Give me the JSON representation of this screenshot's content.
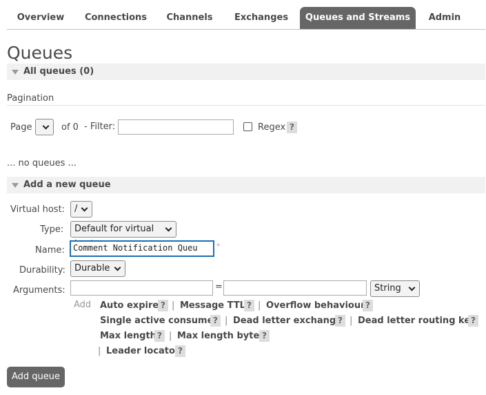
{
  "tabs": [
    {
      "label": "Overview"
    },
    {
      "label": "Connections"
    },
    {
      "label": "Channels"
    },
    {
      "label": "Exchanges"
    },
    {
      "label": "Queues and Streams",
      "active": true
    },
    {
      "label": "Admin"
    }
  ],
  "page_title": "Queues",
  "all_queues": {
    "label": "All queues (0)"
  },
  "pagination": {
    "label": "Pagination",
    "page_label": "Page",
    "of_text": "of 0",
    "filter_label": "- Filter:",
    "filter_value": "",
    "regex_label": "Regex",
    "regex_checked": false,
    "help": "?"
  },
  "no_queues_text": "... no queues ...",
  "add_queue_section": {
    "header": "Add a new queue",
    "virtual_host": {
      "label": "Virtual host:",
      "value": "/"
    },
    "type": {
      "label": "Type:",
      "value": "Default for virtual host"
    },
    "name": {
      "label": "Name:",
      "value": "Comment Notification Queu",
      "required_mark": "*"
    },
    "durability": {
      "label": "Durability:",
      "value": "Durable"
    },
    "arguments": {
      "label": "Arguments:",
      "key_value": "",
      "equals": "=",
      "value_value": "",
      "type_value": "String",
      "add_label": "Add",
      "shortcuts": {
        "auto_expire": "Auto expire",
        "message_ttl": "Message TTL",
        "overflow_behaviour": "Overflow behaviour",
        "single_active_consumer": "Single active consumer",
        "dead_letter_exchange": "Dead letter exchange",
        "dead_letter_routing_key": "Dead letter routing key",
        "max_length": "Max length",
        "max_length_bytes": "Max length bytes",
        "leader_locator": "Leader locator"
      },
      "separator": "|",
      "help": "?"
    },
    "submit_label": "Add queue"
  },
  "colors": {
    "active_tab": "#666666",
    "section_bg": "#f1f1f1",
    "focus_border": "#1a6fb5"
  }
}
